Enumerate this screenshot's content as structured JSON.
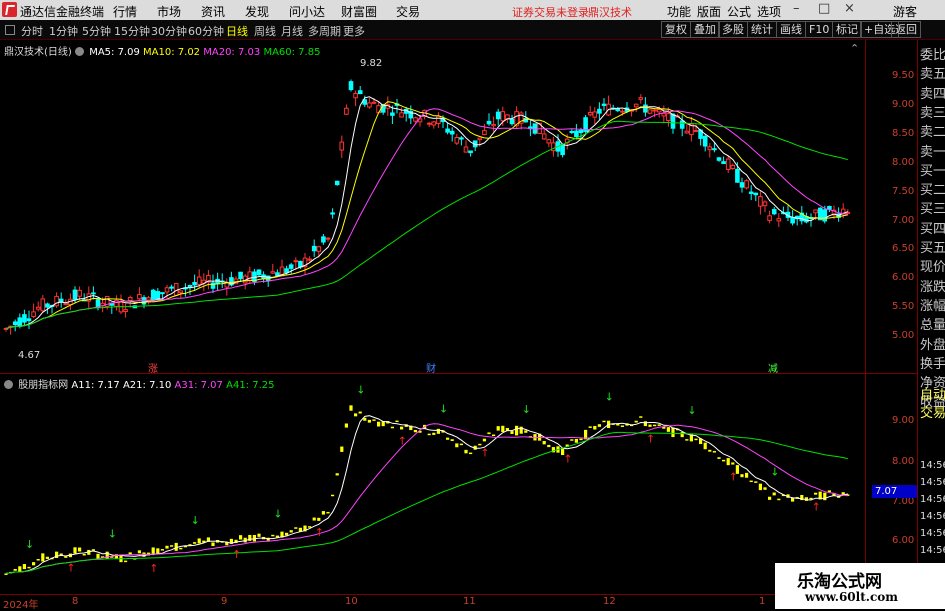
{
  "window": {
    "app_title": "通达信金融终端",
    "menu": [
      "行情",
      "市场",
      "资讯",
      "发现",
      "问小达",
      "财富圈",
      "交易"
    ],
    "warning": "证券交易未登录",
    "user": "鼎汉技术",
    "right_menu": [
      "功能",
      "版面",
      "公式",
      "选项"
    ],
    "guest": "游客"
  },
  "toolbar": {
    "periods": [
      "分时",
      "1分钟",
      "5分钟",
      "15分钟",
      "30分钟",
      "60分钟",
      "日线",
      "周线",
      "月线",
      "多周期",
      "更多"
    ],
    "active_period": "日线",
    "right_buttons": [
      "复权",
      "叠加",
      "多股",
      "统计",
      "画线",
      "F10",
      "标记",
      "+自选",
      "返回"
    ]
  },
  "main_panel": {
    "stock": "鼎汉技术(日线)",
    "indicators": [
      {
        "label": "MA5: 7.09",
        "color": "#ffffff"
      },
      {
        "label": "MA10: 7.02",
        "color": "#ffff00"
      },
      {
        "label": "MA20: 7.03",
        "color": "#ff44ff"
      },
      {
        "label": "MA60: 7.85",
        "color": "#00e000"
      }
    ],
    "y_ticks": [
      "9.50",
      "9.00",
      "8.50",
      "8.00",
      "7.50",
      "7.00",
      "6.50",
      "6.00",
      "5.50",
      "5.00"
    ],
    "high_label": "9.82",
    "low_label": "4.67",
    "marks": [
      {
        "text": "涨",
        "color": "#ff4040"
      },
      {
        "text": "财",
        "color": "#4080ff"
      },
      {
        "text": "减",
        "color": "#40ff40"
      }
    ]
  },
  "sub_panel": {
    "name": "股朋指标网",
    "indicators": [
      {
        "label": "A11: 7.17",
        "color": "#ffffff"
      },
      {
        "label": "A21: 7.10",
        "color": "#ffffff"
      },
      {
        "label": "A31: 7.07",
        "color": "#ff44ff"
      },
      {
        "label": "A41: 7.25",
        "color": "#00e000"
      }
    ],
    "y_ticks": [
      "9.00",
      "8.00",
      "7.00",
      "6.00"
    ],
    "current_value": "7.07"
  },
  "x_axis": {
    "labels": [
      "2024年",
      "8",
      "9",
      "10",
      "11",
      "12",
      "1"
    ]
  },
  "side_panel": {
    "items": [
      "委比",
      "卖五",
      "卖四",
      "卖三",
      "卖二",
      "卖一",
      "买一",
      "买二",
      "买三",
      "买四",
      "买五",
      "现价",
      "涨跌",
      "涨幅",
      "总量",
      "外盘",
      "换手",
      "净资",
      "收益"
    ],
    "auto": [
      "自动",
      "交易"
    ],
    "times": [
      "14:56",
      "14:56",
      "14:56",
      "14:56",
      "14:56",
      "14:56",
      "14:56",
      "14:56"
    ]
  },
  "watermark": {
    "line1": "乐淘公式网",
    "line2": "www.60lt.com"
  },
  "colors": {
    "up": "#ff3232",
    "down": "#00ffff",
    "grid": "#7a0000",
    "sub_bar": "#ffff00"
  }
}
